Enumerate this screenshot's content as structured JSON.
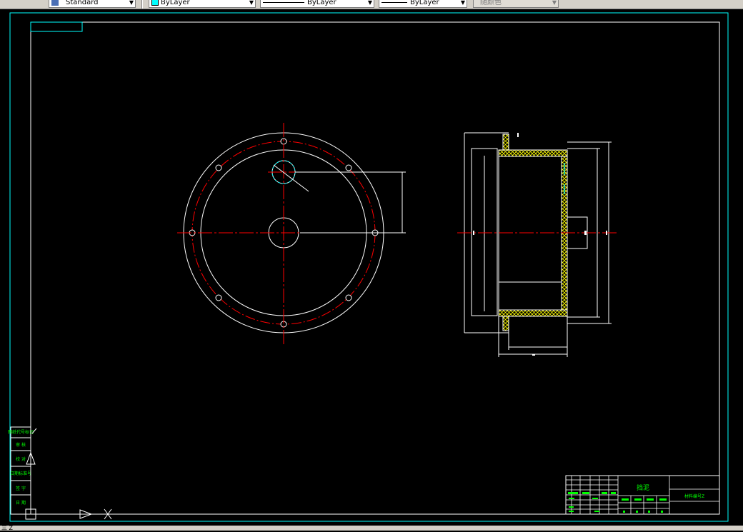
{
  "toolbar": {
    "text_style": "Standard",
    "layer": "ByLayer",
    "linetype": "ByLayer",
    "lineweight": "ByLayer",
    "plot_style": "随颜色"
  },
  "colors": {
    "drawing_bg": "#000000",
    "frame": "#00ffff",
    "geometry": "#ffffff",
    "centerline": "#ff0000",
    "hatch": "#ffff00",
    "title_text": "#00ff00"
  },
  "titleblock": {
    "part_name": "挡泥",
    "drawing_no": "材料编号Z",
    "left_labels": [
      "图纸代号标记",
      "审 核",
      "校 对",
      "日期标准号",
      "签 字",
      "日 期"
    ]
  },
  "status": {
    "text": "三 Z"
  }
}
